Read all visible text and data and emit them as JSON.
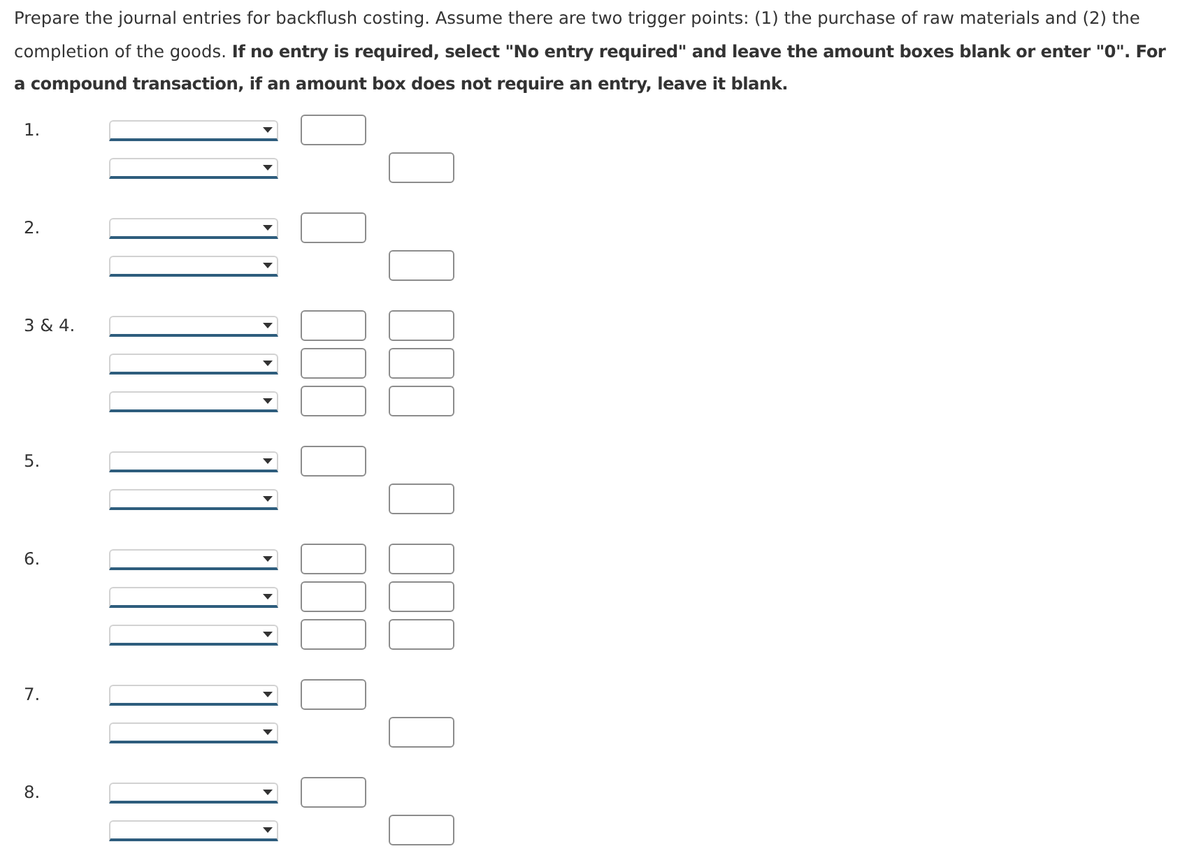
{
  "instructions": "Prepare the journal entries for backflush costing. Assume there are two trigger points: (1) the purchase of raw materials and (2) the completion of the goods. **If no entry is required, select \"No entry required\" and leave the amount boxes blank or enter \"0\". For a compound transaction, if an amount box does not require an entry, leave it blank.**",
  "entries": [
    {
      "label": "1.",
      "lines": [
        {
          "kind": "debit"
        },
        {
          "kind": "credit"
        }
      ]
    },
    {
      "label": "2.",
      "lines": [
        {
          "kind": "debit"
        },
        {
          "kind": "credit"
        }
      ]
    },
    {
      "label": "3 & 4.",
      "lines": [
        {
          "kind": "both"
        },
        {
          "kind": "both"
        },
        {
          "kind": "both"
        }
      ]
    },
    {
      "label": "5.",
      "lines": [
        {
          "kind": "debit"
        },
        {
          "kind": "credit"
        }
      ]
    },
    {
      "label": "6.",
      "lines": [
        {
          "kind": "both"
        },
        {
          "kind": "both"
        },
        {
          "kind": "both"
        }
      ]
    },
    {
      "label": "7.",
      "lines": [
        {
          "kind": "debit"
        },
        {
          "kind": "credit"
        }
      ]
    },
    {
      "label": "8.",
      "lines": [
        {
          "kind": "debit"
        },
        {
          "kind": "credit"
        }
      ]
    }
  ]
}
